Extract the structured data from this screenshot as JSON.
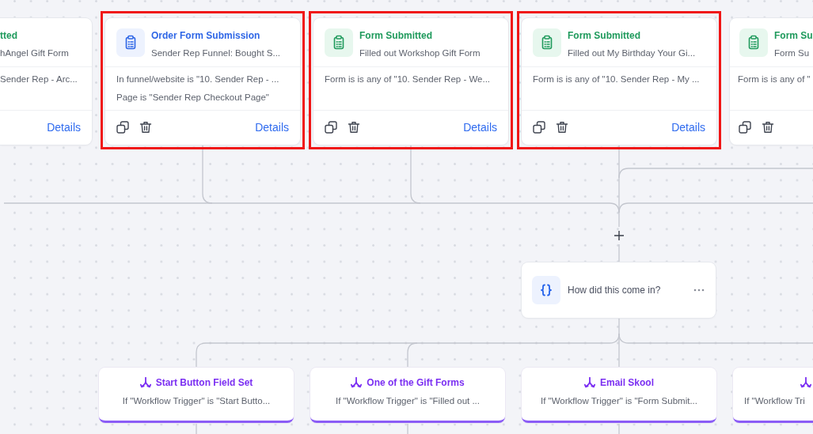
{
  "triggers": [
    {
      "kind": "form_submitted",
      "title": "tted",
      "subtitle": "hAngel Gift Form",
      "conditions": [
        "Sender Rep - Arc..."
      ],
      "link": "Details",
      "highlighted": false
    },
    {
      "kind": "order_form",
      "title": "Order Form Submission",
      "subtitle": "Sender Rep Funnel: Bought S...",
      "conditions": [
        "In funnel/website is \"10. Sender Rep - ...",
        "Page is \"Sender Rep Checkout Page\""
      ],
      "link": "Details",
      "highlighted": true
    },
    {
      "kind": "form_submitted",
      "title": "Form Submitted",
      "subtitle": "Filled out Workshop Gift Form",
      "conditions": [
        "Form is is any of \"10. Sender Rep - We..."
      ],
      "link": "Details",
      "highlighted": true
    },
    {
      "kind": "form_submitted",
      "title": "Form Submitted",
      "subtitle": "Filled out My Birthday Your Gi...",
      "conditions": [
        "Form is is any of \"10. Sender Rep - My ..."
      ],
      "link": "Details",
      "highlighted": true
    },
    {
      "kind": "form_submitted",
      "title": "Form Su",
      "subtitle": "Form Su",
      "conditions": [
        "Form is is any of \""
      ],
      "highlighted": false
    }
  ],
  "decision": {
    "label": "How did this come in?"
  },
  "branches": [
    {
      "title": "Start Button Field Set",
      "condition": "If \"Workflow Trigger\" is \"Start Butto..."
    },
    {
      "title": "One of the Gift Forms",
      "condition": "If \"Workflow Trigger\" is \"Filled out ..."
    },
    {
      "title": "Email Skool",
      "condition": "If \"Workflow Trigger\" is \"Form Submit..."
    },
    {
      "condition": "If \"Workflow Tri"
    }
  ]
}
